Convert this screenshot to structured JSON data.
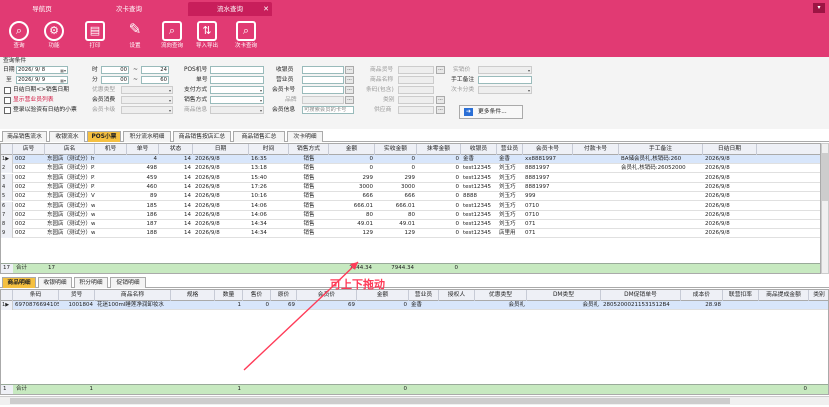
{
  "tabs": [
    {
      "label": "导航页",
      "active": false
    },
    {
      "label": "次卡查询",
      "active": false
    },
    {
      "label": "流水查询",
      "active": true
    }
  ],
  "window_button": "▾",
  "toolbar": [
    {
      "label": "查询",
      "icon": "search-icon"
    },
    {
      "label": "功能",
      "icon": "gear-icon"
    },
    {
      "label": "打印",
      "icon": "printer-icon"
    },
    {
      "label": "设置",
      "icon": "wrench-icon"
    },
    {
      "label": "流向查询",
      "icon": "document-search-icon"
    },
    {
      "label": "导入导出",
      "icon": "import-export-icon"
    },
    {
      "label": "次卡查询",
      "icon": "card-search-icon"
    }
  ],
  "conditions": {
    "section_label": "查询条件",
    "date_from_label": "日期",
    "date_from": "2026/ 9/ 8",
    "date_to_label": "至",
    "date_to": "2026/ 9/ 9",
    "time_hour_label": "时",
    "time_from_h": "00",
    "time_to_h": "24",
    "time_min_label": "分",
    "time_from_m": "00",
    "time_to_m": "60",
    "tilde": "~",
    "pos_label": "POS机号",
    "bill_label": "单号",
    "pay_label": "支付方式",
    "sale_label": "销售方式",
    "cashier_label": "收银员",
    "clerk_label": "营业员",
    "member_card_label": "会员卡号",
    "brand_label": "品牌",
    "member_info_label": "会员信息",
    "member_info_placeholder": "可搜索会员的卡号",
    "product_code_label": "商品货号",
    "product_name_label": "商品名称",
    "barcode_label": "条码(包含)",
    "category_label": "类别",
    "supplier_label": "供应商",
    "spec_type_label": "实销价",
    "manual_note_label": "手工备注",
    "count_card_label": "次卡分类",
    "cb_member_date": "日结日期<>销售日期",
    "cb_show_clerk": "显示营业员列表",
    "cb_no_close": "登录以验资有日结的小票",
    "promo_label": "优惠类型",
    "member_consume_label": "会员消费",
    "member_grade_label": "会员卡级",
    "product_info_label": "商品信息",
    "more_conditions": "更多条件...",
    "dots": "..."
  },
  "report_tabs": [
    {
      "label": "商品销售流水",
      "active": false
    },
    {
      "label": "收银流水",
      "active": false
    },
    {
      "label": "POS小票",
      "active": true
    },
    {
      "label": "积分流水明细",
      "active": false
    },
    {
      "label": "商品销售按店汇总",
      "active": false
    },
    {
      "label": "商品销售汇总",
      "active": false
    },
    {
      "label": "次卡明细",
      "active": false
    }
  ],
  "grid1": {
    "columns": [
      "店号",
      "店名",
      "机号",
      "单号",
      "状态",
      "日期",
      "时间",
      "销售方式",
      "金额",
      "实收金额",
      "抹零金额",
      "收银员",
      "营业员",
      "会员卡号",
      "付款卡号",
      "手工备注",
      "日结日期"
    ],
    "rows": [
      {
        "n": "1",
        "mark": "▶",
        "store": "002",
        "name": "东园店（测试分）hyl",
        "pos": "",
        "bill": "4",
        "status": "14",
        "date": "2026/9/8",
        "time": "16:35",
        "sale": "销售",
        "amt": "0",
        "real": "0",
        "round": "0",
        "cashier": "金香",
        "clerk": "金香",
        "card": "xx8881997",
        "pay": "",
        "note": "BA储会员礼,核销码:260",
        "close": "2026/9/8"
      },
      {
        "n": "2",
        "mark": "",
        "store": "002",
        "name": "东园店（测试分）P28",
        "pos": "",
        "bill": "498",
        "status": "14",
        "date": "2026/9/8",
        "time": "13:18",
        "sale": "销售",
        "amt": "0",
        "real": "0",
        "round": "0",
        "cashier": "test12345",
        "clerk": "刘玉巧",
        "card": "8881997",
        "pay": "",
        "note": "会员礼,核销码:26052000",
        "close": "2026/9/8"
      },
      {
        "n": "3",
        "mark": "",
        "store": "002",
        "name": "东园店（测试分）P28",
        "pos": "",
        "bill": "459",
        "status": "14",
        "date": "2026/9/8",
        "time": "15:40",
        "sale": "销售",
        "amt": "299",
        "real": "299",
        "round": "0",
        "cashier": "test12345",
        "clerk": "刘玉巧",
        "card": "8881997",
        "pay": "",
        "note": "",
        "close": "2026/9/8"
      },
      {
        "n": "4",
        "mark": "",
        "store": "002",
        "name": "东园店（测试分）P28",
        "pos": "",
        "bill": "460",
        "status": "14",
        "date": "2026/9/8",
        "time": "17:26",
        "sale": "销售",
        "amt": "3000",
        "real": "3000",
        "round": "0",
        "cashier": "test12345",
        "clerk": "刘玉巧",
        "card": "8881997",
        "pay": "",
        "note": "",
        "close": "2026/9/8"
      },
      {
        "n": "5",
        "mark": "",
        "store": "002",
        "name": "东园店（测试分）V60",
        "pos": "",
        "bill": "89",
        "status": "14",
        "date": "2026/9/8",
        "time": "10:16",
        "sale": "销售",
        "amt": "666",
        "real": "666",
        "round": "0",
        "cashier": "8888",
        "clerk": "刘玉巧",
        "card": "999",
        "pay": "",
        "note": "",
        "close": "2026/9/8"
      },
      {
        "n": "6",
        "mark": "",
        "store": "002",
        "name": "东园店（测试分）www",
        "pos": "",
        "bill": "185",
        "status": "14",
        "date": "2026/9/8",
        "time": "14:06",
        "sale": "销售",
        "amt": "666.01",
        "real": "666.01",
        "round": "0",
        "cashier": "test12345",
        "clerk": "刘玉巧",
        "card": "0710",
        "pay": "",
        "note": "",
        "close": "2026/9/8"
      },
      {
        "n": "7",
        "mark": "",
        "store": "002",
        "name": "东园店（测试分）www",
        "pos": "",
        "bill": "186",
        "status": "14",
        "date": "2026/9/8",
        "time": "14:06",
        "sale": "销售",
        "amt": "80",
        "real": "80",
        "round": "0",
        "cashier": "test12345",
        "clerk": "刘玉巧",
        "card": "0710",
        "pay": "",
        "note": "",
        "close": "2026/9/8"
      },
      {
        "n": "8",
        "mark": "",
        "store": "002",
        "name": "东园店（测试分）www",
        "pos": "",
        "bill": "187",
        "status": "14",
        "date": "2026/9/8",
        "time": "14:34",
        "sale": "销售",
        "amt": "49.01",
        "real": "49.01",
        "round": "0",
        "cashier": "test12345",
        "clerk": "刘玉巧",
        "card": "071",
        "pay": "",
        "note": "",
        "close": "2026/9/8"
      },
      {
        "n": "9",
        "mark": "",
        "store": "002",
        "name": "东园店（测试分）www",
        "pos": "",
        "bill": "188",
        "status": "14",
        "date": "2026/9/8",
        "time": "14:34",
        "sale": "销售",
        "amt": "129",
        "real": "129",
        "round": "0",
        "cashier": "test12345",
        "clerk": "店里用",
        "card": "071",
        "pay": "",
        "note": "",
        "close": "2026/9/8"
      }
    ],
    "summary": {
      "n": "17",
      "label": "合计",
      "count": "17",
      "amt": "7944.34",
      "real": "7944.34",
      "round": "0"
    }
  },
  "detail_tabs": [
    {
      "label": "商品明细",
      "active": true
    },
    {
      "label": "收银明细",
      "active": false
    },
    {
      "label": "积分明细",
      "active": false
    },
    {
      "label": "促销明细",
      "active": false
    }
  ],
  "grid2": {
    "columns": [
      "条码",
      "货号",
      "商品名称",
      "规格",
      "数量",
      "售价",
      "原价",
      "会员价",
      "金额",
      "营业员",
      "授权人",
      "优惠类型",
      "DM类型",
      "DM促销单号",
      "成本价",
      "联营扣率",
      "商品提成金额",
      "类别"
    ],
    "rows": [
      {
        "n": "1",
        "mark": "▶",
        "barcode": "6970876694105",
        "code": "1001804",
        "name": "花迷100ml睡莲净润卸妆水",
        "spec": "",
        "qty": "1",
        "price": "0",
        "orig": "69",
        "member": "69",
        "amt": "0",
        "clerk": "金香",
        "auth": "",
        "promo": "会员礼",
        "dm": "会员礼",
        "dmno": "28052000211531512B4",
        "cost": "28.98",
        "rate": "",
        "commission": "",
        "cat": ""
      }
    ],
    "summary": {
      "label": "合计",
      "count": "1",
      "qty": "1",
      "amt": "0",
      "commission": "0"
    }
  },
  "annotation": "可上下拖动",
  "colors": {
    "brand": "#e13a73",
    "active_tab": "#f5c040",
    "summary": "#c7e9c0",
    "annotation": "#ff3b58"
  }
}
